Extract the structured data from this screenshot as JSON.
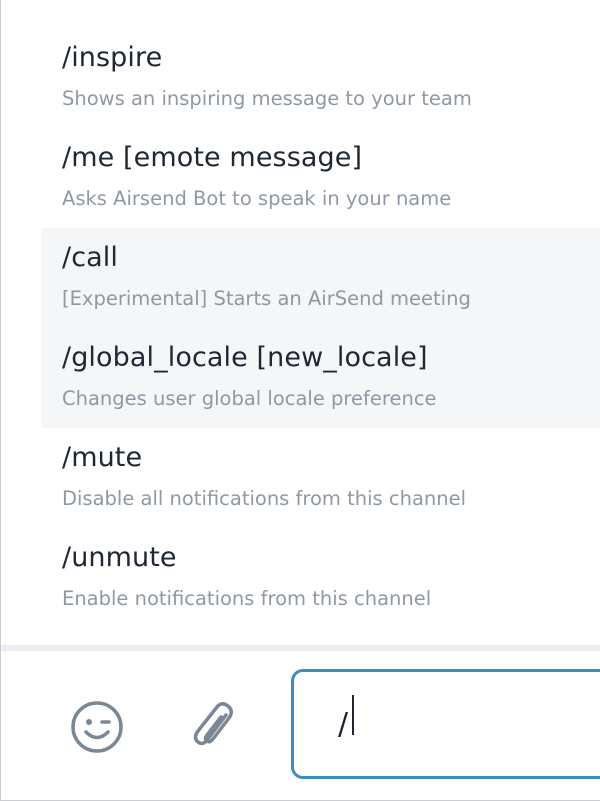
{
  "commands": [
    {
      "name": "/inspire",
      "description": "Shows an inspiring message to your team"
    },
    {
      "name": "/me [emote message]",
      "description": "Asks Airsend Bot to speak in your name"
    },
    {
      "name": "/call",
      "description": "[Experimental] Starts an AirSend meeting"
    },
    {
      "name": "/global_locale [new_locale]",
      "description": "Changes user global locale preference"
    },
    {
      "name": "/mute",
      "description": "Disable all notifications from this channel"
    },
    {
      "name": "/unmute",
      "description": "Enable notifications from this channel"
    }
  ],
  "composer": {
    "input_value": "/",
    "emoji_icon": "smiley-face-icon",
    "attach_icon": "paperclip-icon"
  },
  "colors": {
    "accent": "#3a8fbd",
    "command_text": "#1f2733",
    "description_text": "#8f98a3",
    "highlight_bg": "#f5f6f8"
  }
}
